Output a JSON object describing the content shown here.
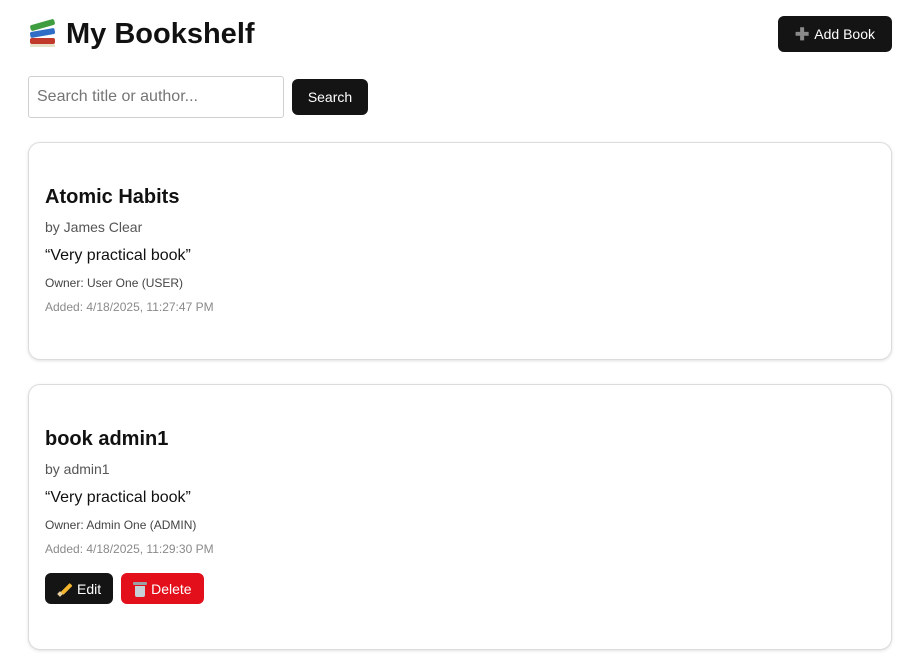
{
  "header": {
    "title": "My Bookshelf",
    "logo_icon": "books-icon",
    "add_button_label": "Add Book",
    "add_button_icon": "plus-icon"
  },
  "search": {
    "placeholder": "Search title or author...",
    "value": "",
    "button_label": "Search"
  },
  "books": [
    {
      "title": "Atomic Habits",
      "author": "by James Clear",
      "review": "“Very practical book”",
      "owner": "Owner: User One (USER)",
      "added": "Added: 4/18/2025, 11:27:47 PM"
    },
    {
      "title": "book admin1",
      "author": "by admin1",
      "review": "“Very practical book”",
      "owner": "Owner: Admin One (ADMIN)",
      "added": "Added: 4/18/2025, 11:29:30 PM",
      "actions": {
        "edit_label": "Edit",
        "edit_icon": "pencil-icon",
        "delete_label": "Delete",
        "delete_icon": "trash-icon"
      }
    }
  ],
  "colors": {
    "primary_button": "#141414",
    "danger_button": "#e3101b",
    "border": "#dcdcdc"
  }
}
